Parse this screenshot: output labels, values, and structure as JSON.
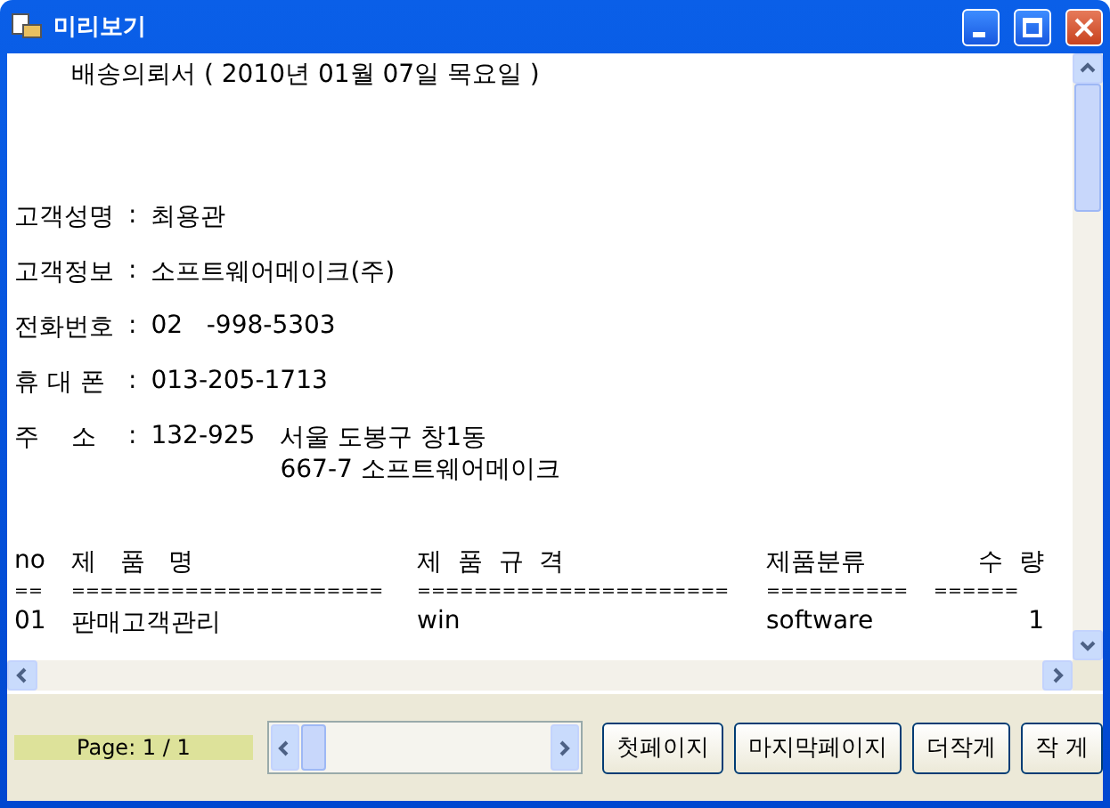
{
  "window": {
    "title": "미리보기"
  },
  "document": {
    "heading": "배송의뢰서 ( 2010년 01월 07일 목요일 )",
    "fields": [
      {
        "kind": "text",
        "label": "고객성명",
        "sep": ":",
        "value": "최용관"
      },
      {
        "kind": "text",
        "label": "고객정보",
        "sep": ":",
        "value": "소프트웨어메이크(주)"
      },
      {
        "kind": "text",
        "label": "전화번호",
        "sep": ":",
        "value": "02   -998-5303"
      },
      {
        "kind": "text",
        "label": "휴 대 폰",
        "sep": ":",
        "value": "013-205-1713"
      },
      {
        "kind": "address",
        "label": "주    소",
        "sep": ":",
        "zip": "132-925",
        "lines": [
          "서울 도봉구 창1동",
          "667-7 소프트웨어메이크"
        ]
      }
    ],
    "table": {
      "columns": [
        "no",
        "제   품   명",
        "제  품  규  격",
        "제품분류",
        "수  량"
      ],
      "separators": [
        "==",
        "======================",
        "======================",
        "==========",
        "======"
      ],
      "rows": [
        [
          "01",
          "판매고객관리",
          "win",
          "software",
          "1"
        ]
      ]
    }
  },
  "footer": {
    "page": "Page:  1  /  1",
    "buttons": [
      "첫페이지",
      "마지막페이지",
      "더작게",
      "작 게"
    ]
  }
}
